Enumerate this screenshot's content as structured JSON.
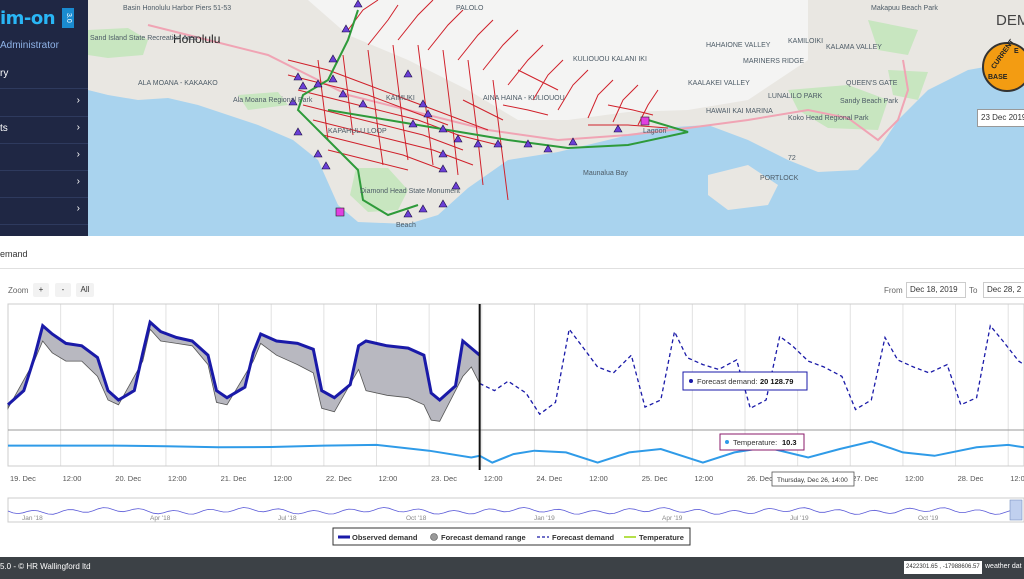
{
  "sidebar": {
    "logo": "im-on",
    "logo_badge": "3.0",
    "user": "Administrator",
    "items": [
      {
        "label": "ry",
        "chevron": ""
      },
      {
        "label": "",
        "chevron": "›"
      },
      {
        "label": "ts",
        "chevron": "›"
      },
      {
        "label": "",
        "chevron": "›"
      },
      {
        "label": "",
        "chevron": "›"
      },
      {
        "label": "",
        "chevron": "›"
      }
    ]
  },
  "map": {
    "labels": {
      "honolulu": "Honolulu",
      "ala_moana": "ALA MOANA - KAKAAKO",
      "ala_moana_park": "Ala Moana Regional Park",
      "sand_island": "Sand Island State Recreation Area",
      "harbor": "Basin Honolulu Harbor Piers 51-53",
      "diamond_head": "Diamond Head State Monument",
      "maunalua_bay": "Maunalua Bay",
      "portlock": "PORTLOCK",
      "kuliouou": "KULIOUOU KALANI IKI",
      "aina_haina": "AINA HAINA - KULIOUOU",
      "hahaione": "HAHAIONE VALLEY",
      "mariners_ridge": "MARINERS RIDGE",
      "kamiloiki": "KAMILOIKI",
      "kalama_valley": "KALAMA VALLEY",
      "makapuu": "Makapuu Beach Park",
      "queens_gate": "QUEEN'S GATE",
      "sandy_beach": "Sandy Beach Park",
      "lunalilo_park": "LUNALILO PARK",
      "koko_head": "Koko Head Regional Park",
      "kaalakei": "KAALAKEI VALLEY",
      "hawaii_kai": "HAWAII KAI MARINA",
      "kapahulu": "KAPAHULU LOOP",
      "palolo": "PALOLO",
      "kaimuki": "KAIMUKI",
      "lagoon": "Lagoon",
      "beach": "Beach",
      "route_72": "72"
    },
    "title": "DEM",
    "gauge": {
      "top": "CURRENT",
      "bottom": "BASE",
      "right": "E"
    },
    "date": "23 Dec 2019"
  },
  "panel": {
    "title": "emand"
  },
  "controls": {
    "zoom_label": "Zoom",
    "zoom_in": "+",
    "zoom_out": "-",
    "zoom_all": "All",
    "from_label": "From",
    "from_value": "Dec 18, 2019",
    "to_label": "To",
    "to_value": "Dec 28, 2"
  },
  "chart_data": {
    "type": "line",
    "title": "",
    "xlabel": "",
    "ylabel": "",
    "x_ticks": [
      "19. Dec",
      "12:00",
      "20. Dec",
      "12:00",
      "21. Dec",
      "12:00",
      "22. Dec",
      "12:00",
      "23. Dec",
      "12:00",
      "24. Dec",
      "12:00",
      "25. Dec",
      "12:00",
      "26. Dec",
      "12:00",
      "27. Dec",
      "12:00",
      "28. Dec",
      "12:00"
    ],
    "x_range_days": [
      0,
      9.65
    ],
    "demand_ylim": [
      0,
      1
    ],
    "temperature_ylim": [
      0,
      1
    ],
    "observed_demand": [
      [
        0,
        0.18
      ],
      [
        0.15,
        0.3
      ],
      [
        0.25,
        0.58
      ],
      [
        0.33,
        0.85
      ],
      [
        0.42,
        0.78
      ],
      [
        0.55,
        0.7
      ],
      [
        0.7,
        0.68
      ],
      [
        0.85,
        0.58
      ],
      [
        0.95,
        0.3
      ],
      [
        1.05,
        0.22
      ],
      [
        1.2,
        0.3
      ],
      [
        1.28,
        0.62
      ],
      [
        1.35,
        0.88
      ],
      [
        1.45,
        0.8
      ],
      [
        1.6,
        0.75
      ],
      [
        1.75,
        0.72
      ],
      [
        1.9,
        0.6
      ],
      [
        1.98,
        0.3
      ],
      [
        2.08,
        0.24
      ],
      [
        2.25,
        0.33
      ],
      [
        2.33,
        0.62
      ],
      [
        2.4,
        0.78
      ],
      [
        2.55,
        0.72
      ],
      [
        2.75,
        0.7
      ],
      [
        2.9,
        0.65
      ],
      [
        2.98,
        0.3
      ],
      [
        3.1,
        0.24
      ],
      [
        3.25,
        0.35
      ],
      [
        3.33,
        0.68
      ],
      [
        3.4,
        0.72
      ],
      [
        3.6,
        0.68
      ],
      [
        3.8,
        0.66
      ],
      [
        3.95,
        0.6
      ],
      [
        4.02,
        0.28
      ],
      [
        4.1,
        0.22
      ],
      [
        4.25,
        0.34
      ],
      [
        4.32,
        0.72
      ],
      [
        4.4,
        0.66
      ],
      [
        4.48,
        0.6
      ]
    ],
    "forecast_demand_range_lower": [
      [
        0,
        0.15
      ],
      [
        0.25,
        0.55
      ],
      [
        0.33,
        0.72
      ],
      [
        0.42,
        0.62
      ],
      [
        0.55,
        0.55
      ],
      [
        0.7,
        0.55
      ],
      [
        0.85,
        0.42
      ],
      [
        0.95,
        0.22
      ],
      [
        1.05,
        0.18
      ],
      [
        1.28,
        0.55
      ],
      [
        1.35,
        0.82
      ],
      [
        1.45,
        0.72
      ],
      [
        1.6,
        0.7
      ],
      [
        1.75,
        0.68
      ],
      [
        1.9,
        0.52
      ],
      [
        1.98,
        0.2
      ],
      [
        2.08,
        0.18
      ],
      [
        2.33,
        0.55
      ],
      [
        2.4,
        0.7
      ],
      [
        2.55,
        0.6
      ],
      [
        2.75,
        0.52
      ],
      [
        2.9,
        0.45
      ],
      [
        2.98,
        0.15
      ],
      [
        3.1,
        0.12
      ],
      [
        3.33,
        0.48
      ],
      [
        3.4,
        0.3
      ],
      [
        3.6,
        0.26
      ],
      [
        3.8,
        0.24
      ],
      [
        3.95,
        0.18
      ],
      [
        4.02,
        0.05
      ],
      [
        4.1,
        0.04
      ],
      [
        4.32,
        0.42
      ],
      [
        4.4,
        0.5
      ],
      [
        4.48,
        0.36
      ]
    ],
    "forecast_demand": [
      [
        4.48,
        0.36
      ],
      [
        4.62,
        0.3
      ],
      [
        4.75,
        0.38
      ],
      [
        4.92,
        0.28
      ],
      [
        5.05,
        0.1
      ],
      [
        5.2,
        0.2
      ],
      [
        5.33,
        0.82
      ],
      [
        5.45,
        0.68
      ],
      [
        5.6,
        0.5
      ],
      [
        5.75,
        0.45
      ],
      [
        5.92,
        0.6
      ],
      [
        6.05,
        0.16
      ],
      [
        6.2,
        0.22
      ],
      [
        6.33,
        0.8
      ],
      [
        6.45,
        0.58
      ],
      [
        6.6,
        0.52
      ],
      [
        6.75,
        0.48
      ],
      [
        6.92,
        0.56
      ],
      [
        7.05,
        0.15
      ],
      [
        7.2,
        0.22
      ],
      [
        7.33,
        0.76
      ],
      [
        7.45,
        0.68
      ],
      [
        7.6,
        0.55
      ],
      [
        7.75,
        0.5
      ],
      [
        7.92,
        0.42
      ],
      [
        8.05,
        0.14
      ],
      [
        8.2,
        0.22
      ],
      [
        8.33,
        0.75
      ],
      [
        8.45,
        0.56
      ],
      [
        8.6,
        0.5
      ],
      [
        8.75,
        0.45
      ],
      [
        8.92,
        0.52
      ],
      [
        9.05,
        0.18
      ],
      [
        9.2,
        0.24
      ],
      [
        9.33,
        0.85
      ],
      [
        9.45,
        0.72
      ],
      [
        9.6,
        0.55
      ],
      [
        9.65,
        0.52
      ]
    ],
    "temperature": [
      [
        0,
        0.6
      ],
      [
        1,
        0.6
      ],
      [
        1.5,
        0.58
      ],
      [
        2,
        0.55
      ],
      [
        2.5,
        0.56
      ],
      [
        3,
        0.6
      ],
      [
        3.5,
        0.62
      ],
      [
        4,
        0.45
      ],
      [
        4.4,
        0.25
      ],
      [
        4.48,
        0.3
      ],
      [
        4.6,
        0.1
      ],
      [
        4.8,
        0.35
      ],
      [
        5,
        0.45
      ],
      [
        5.3,
        0.4
      ],
      [
        5.6,
        0.1
      ],
      [
        5.9,
        0.4
      ],
      [
        6.2,
        0.5
      ],
      [
        6.6,
        0.1
      ],
      [
        6.9,
        0.4
      ],
      [
        7.2,
        0.55
      ],
      [
        7.6,
        0.25
      ],
      [
        7.9,
        0.5
      ],
      [
        8.2,
        0.72
      ],
      [
        8.5,
        0.4
      ],
      [
        8.8,
        0.3
      ],
      [
        9.2,
        0.55
      ],
      [
        9.5,
        0.62
      ],
      [
        9.65,
        0.55
      ]
    ],
    "crosshair_x": 4.48,
    "tooltip_forecast": {
      "label": "Forecast demand:",
      "value": "20 128.79"
    },
    "tooltip_temperature": {
      "label": "Temperature:",
      "value": "10.3"
    },
    "crosshair_label": "Thursday, Dec 26, 14:00",
    "navigator_ticks": [
      "Jan '18",
      "Apr '18",
      "Jul '18",
      "Oct '18",
      "Jan '19",
      "Apr '19",
      "Jul '19",
      "Oct '19"
    ],
    "legend": [
      "Observed demand",
      "Forecast demand range",
      "Forecast demand",
      "Temperature"
    ],
    "legend_placement": "bottom",
    "colors": {
      "observed": "#1a1aa8",
      "range": "#b8b8c0",
      "forecast": "#1a1aa8",
      "temperature": "#2f9be8"
    }
  },
  "footer": {
    "version": "5.0 - © HR Wallingford ltd",
    "coords": "2422301.65 , -17988606.57",
    "weather": "weather dat"
  }
}
